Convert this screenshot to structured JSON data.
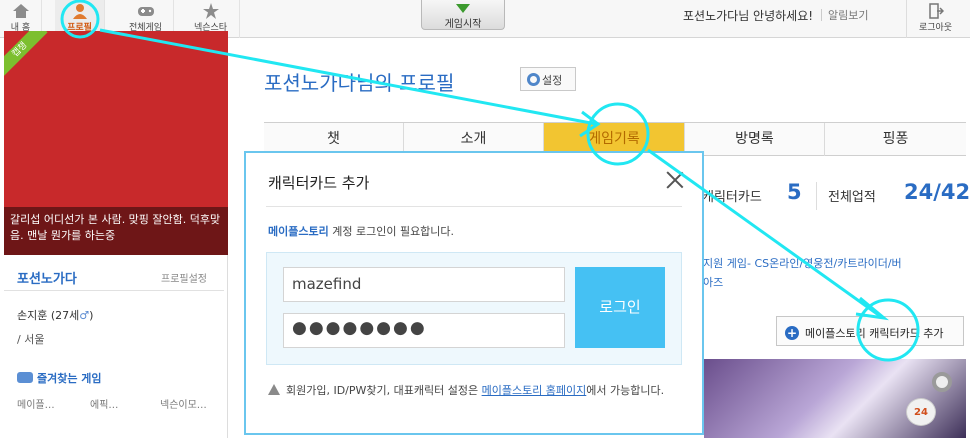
{
  "topnav": {
    "items": [
      {
        "label": "내 홈"
      },
      {
        "label": "프로필"
      },
      {
        "label": "전체게임"
      },
      {
        "label": "넥슨스타"
      }
    ],
    "play_label": "게임시작",
    "greeting": "포션노가다님 안녕하세요!",
    "alerts_label": "알림보기",
    "logout_label": "로그아웃"
  },
  "left": {
    "ribbon": "캡챙",
    "caption": "갈리섭 어디선가 본 사람. 맞핑 잘안함. 덕후맞음. 맨날 뭔가를 하는중",
    "name": "포션노가다",
    "profile_settings": "프로필설정",
    "realname": "손지훈 (27세",
    "gender_icon": "♂",
    "realname_close": ")",
    "location": "/ 서울",
    "fav_label": "즐겨찾는 게임",
    "tags": [
      "메이플…",
      "에픽…",
      "넥슨이모…"
    ]
  },
  "main": {
    "title": "포션노가다님의 프로필",
    "settings_label": "설정",
    "tabs": [
      {
        "label": "챗"
      },
      {
        "label": "소개"
      },
      {
        "label": "게임기록"
      },
      {
        "label": "방명록"
      },
      {
        "label": "핑퐁"
      }
    ],
    "stats": {
      "card_label": "캐릭터카드",
      "card_value": "5",
      "achv_label": "전체업적",
      "achv_value": "24/42"
    },
    "support_text": "지원 게임 - CS온라인/영웅전/카트라이더/버블파이터 등 캐릭터카드를 지원하는 아즈",
    "support_line1": "지원 게임- CS온라인/영웅전/카트라이더/버",
    "support_line2": "아즈",
    "add_card_label": "메이플스토리 캐릭터카드 추가",
    "badge": "24"
  },
  "dialog": {
    "title": "캐릭터카드 추가",
    "msg_game": "메이플스토리",
    "msg_rest": " 계정 로그인이 필요합니다.",
    "id_value": "mazefind",
    "pw_value": "●●●●●●●●",
    "login_label": "로그인",
    "info_prefix": "회원가입, ID/PW찾기, 대표캐릭터 설정은 ",
    "info_link": "메이플스토리 홈페이지",
    "info_suffix": "에서 가능합니다."
  },
  "colors": {
    "accent_blue": "#2a6cc3",
    "active_tab": "#f2c531",
    "login_button": "#45c1f3",
    "annotation": "#21e7f2",
    "dialog_border": "#6ac6ee"
  }
}
